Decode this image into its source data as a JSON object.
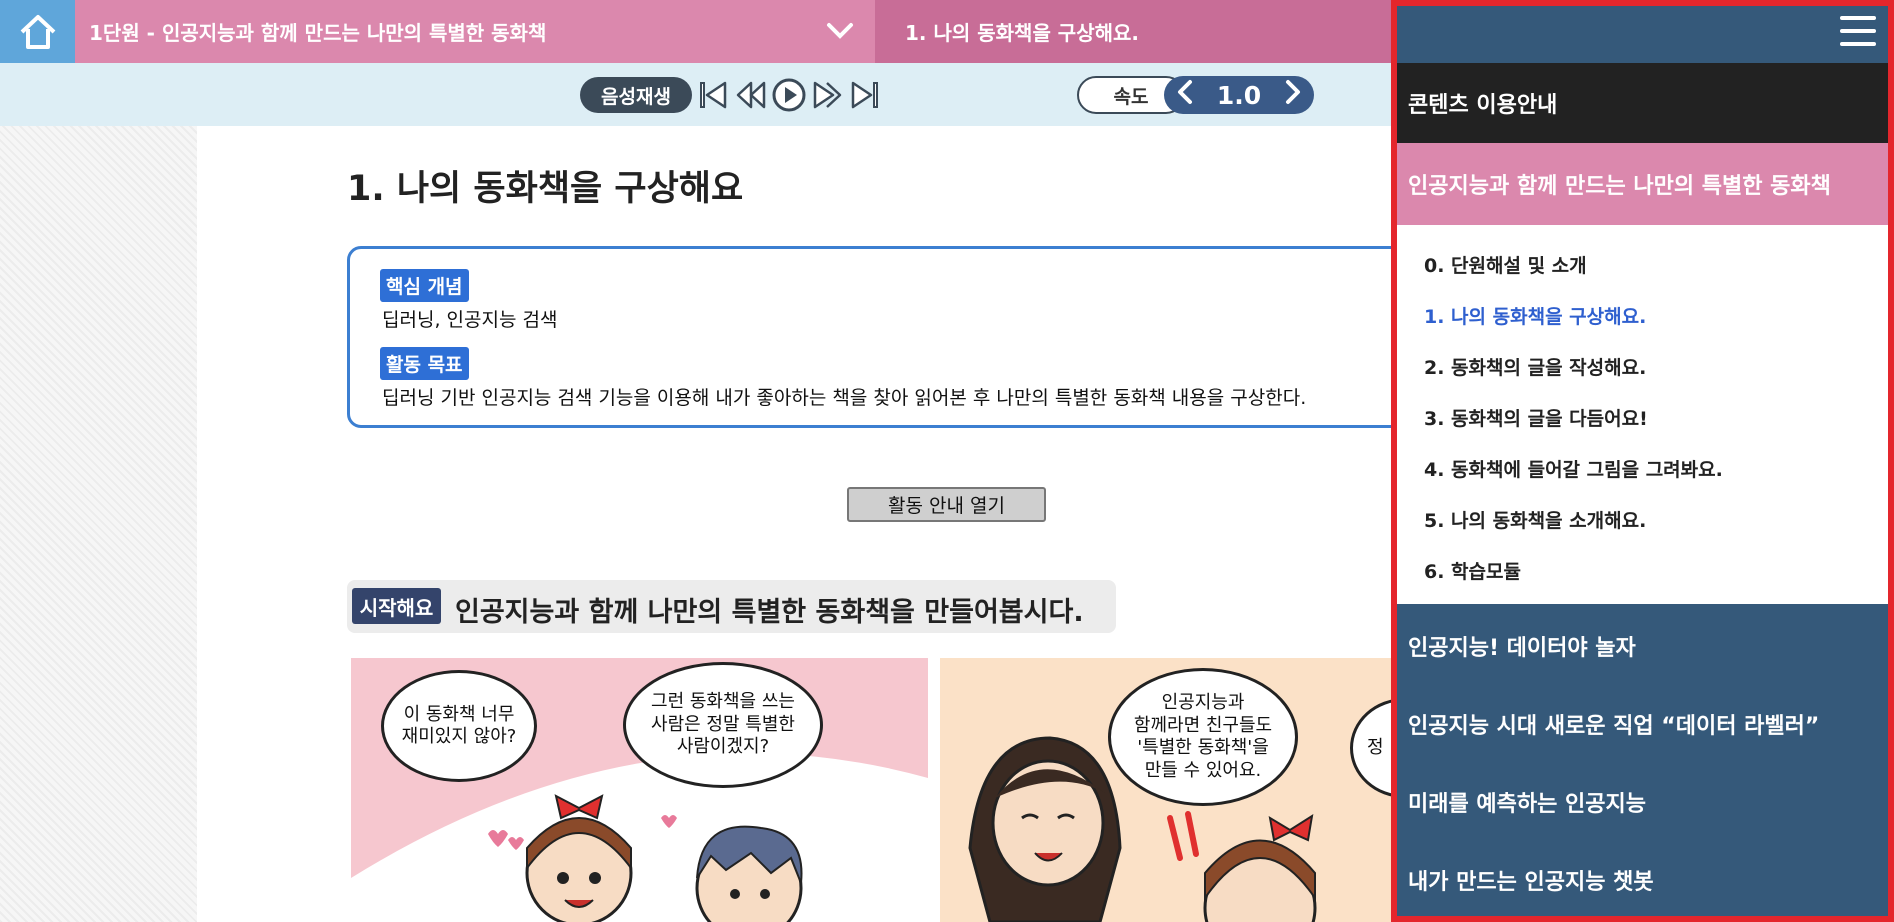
{
  "topbar": {
    "unit_title": "1단원 - 인공지능과 함께 만드는 나만의 특별한 동화책",
    "lesson_title": "1. 나의 동화책을 구상해요."
  },
  "audio": {
    "play_label": "음성재생",
    "speed_label": "속도",
    "speed_value": "1.0"
  },
  "page": {
    "heading": "1. 나의 동화책을 구상해요",
    "concept_badge": "핵심 개념",
    "concept_text": "딥러닝, 인공지능 검색",
    "goal_badge": "활동 목표",
    "goal_text": "딥러닝 기반 인공지능 검색 기능을 이용해 내가 좋아하는 책을 찾아 읽어본 후 나만의 특별한 동화책 내용을 구상한다.",
    "guide_button": "활동 안내 열기",
    "start_badge": "시작해요",
    "start_text": "인공지능과 함께 나만의 특별한 동화책을 만들어봅시다."
  },
  "comic": {
    "bubble1": "이 동화책 너무\n재미있지 않아?",
    "bubble2": "그런 동화책을 쓰는\n사람은 정말 특별한\n사람이겠지?",
    "bubble3": "인공지능과\n함께라면 친구들도\n'특별한 동화책'을\n만들 수 있어요.",
    "bubble4_partial": "정"
  },
  "side_menu": {
    "guide": "콘텐츠 이용안내",
    "active_unit": "인공지능과 함께 만드는 나만의 특별한 동화책",
    "sub_items": [
      "0. 단원해설 및 소개",
      "1. 나의 동화책을 구상해요.",
      "2. 동화책의 글을 작성해요.",
      "3. 동화책의 글을 다듬어요!",
      "4. 동화책에 들어갈 그림을 그려봐요.",
      "5. 나의 동화책을 소개해요.",
      "6. 학습모듈"
    ],
    "active_sub_index": 1,
    "units": [
      "인공지능! 데이터야 놀자",
      "인공지능 시대 새로운 직업 “데이터 라벨러”",
      "미래를 예측하는 인공지능",
      "내가 만드는 인공지능 챗봇"
    ]
  },
  "colors": {
    "topbar_pink": "#c86d97",
    "unit_pink": "#db88ad",
    "home_blue": "#5fa6da",
    "menu_navy": "#35597a",
    "highlight_red": "#e4262c",
    "active_link_blue": "#2e5fcf"
  },
  "icons": {
    "home": "home-icon",
    "chevron": "chevron-down-icon",
    "menu": "hamburger-menu-icon"
  }
}
